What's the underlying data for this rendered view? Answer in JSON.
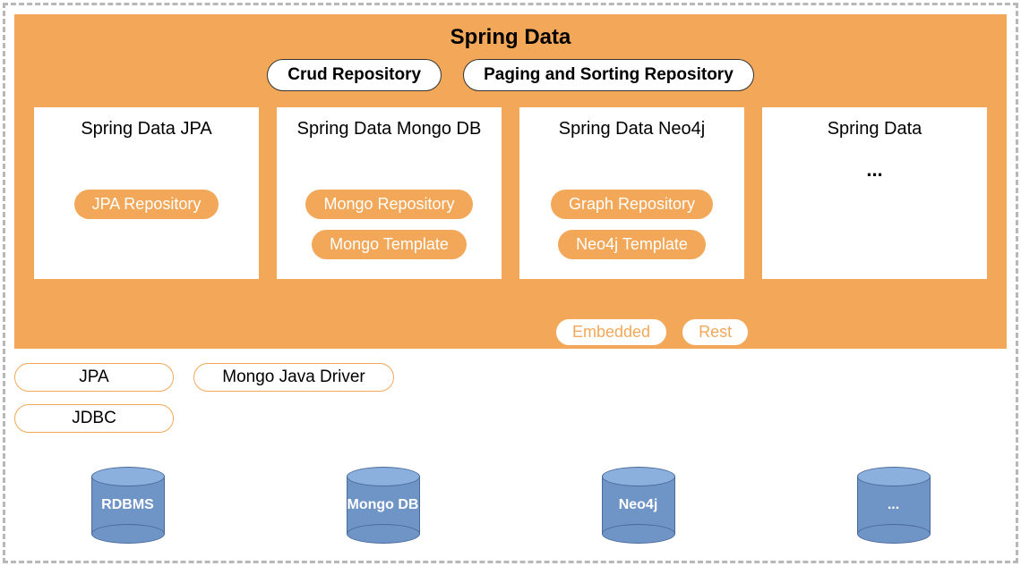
{
  "title": "Spring Data",
  "top_pills": {
    "crud": "Crud Repository",
    "paging": "Paging and Sorting Repository"
  },
  "modules": {
    "jpa": {
      "title": "Spring Data JPA",
      "repo": "JPA Repository"
    },
    "mongo": {
      "title": "Spring Data Mongo DB",
      "repo": "Mongo Repository",
      "template": "Mongo Template"
    },
    "neo4j": {
      "title": "Spring Data Neo4j",
      "repo": "Graph Repository",
      "template": "Neo4j Template",
      "embedded": "Embedded",
      "rest": "Rest"
    },
    "more": {
      "title": "Spring Data",
      "ellipsis": "..."
    }
  },
  "drivers": {
    "jpa": "JPA",
    "jdbc": "JDBC",
    "mongo_driver": "Mongo Java Driver"
  },
  "databases": {
    "rdbms": "RDBMS",
    "mongodb": "Mongo DB",
    "neo4j": "Neo4j",
    "more": "..."
  }
}
